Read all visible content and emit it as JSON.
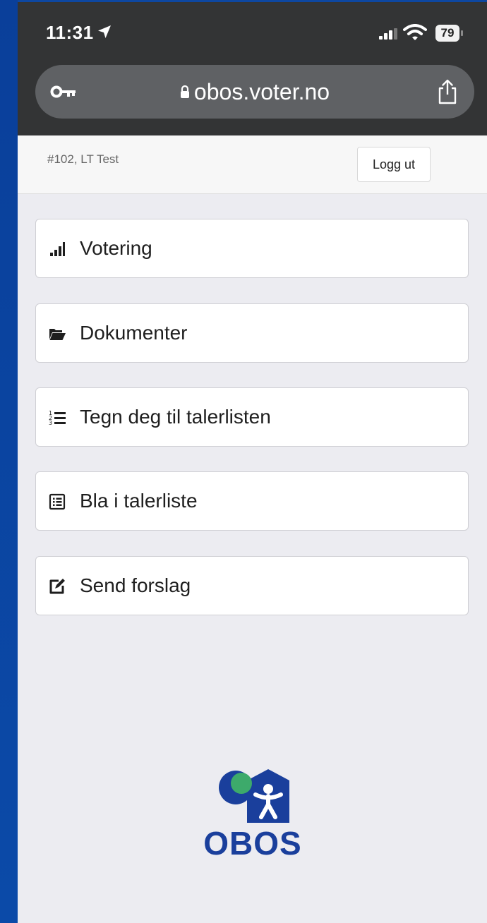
{
  "status_bar": {
    "time": "11:31",
    "battery": "79",
    "icons": [
      "location-arrow-icon",
      "signal-icon",
      "wifi-icon",
      "battery-icon"
    ]
  },
  "browser": {
    "url": "obos.voter.no",
    "icons": [
      "key-icon",
      "lock-icon",
      "share-icon"
    ]
  },
  "header": {
    "user": "#102, LT Test",
    "logout_label": "Logg ut"
  },
  "menu": [
    {
      "label": "Votering",
      "icon": "bar-chart-icon"
    },
    {
      "label": "Dokumenter",
      "icon": "folder-open-icon"
    },
    {
      "label": "Tegn deg til talerlisten",
      "icon": "numbered-list-icon"
    },
    {
      "label": "Bla i talerliste",
      "icon": "list-alt-icon"
    },
    {
      "label": "Send forslag",
      "icon": "edit-icon"
    }
  ],
  "logo": {
    "text": "OBOS",
    "brand_blue": "#1a3f9c",
    "brand_green": "#3daa6b"
  }
}
